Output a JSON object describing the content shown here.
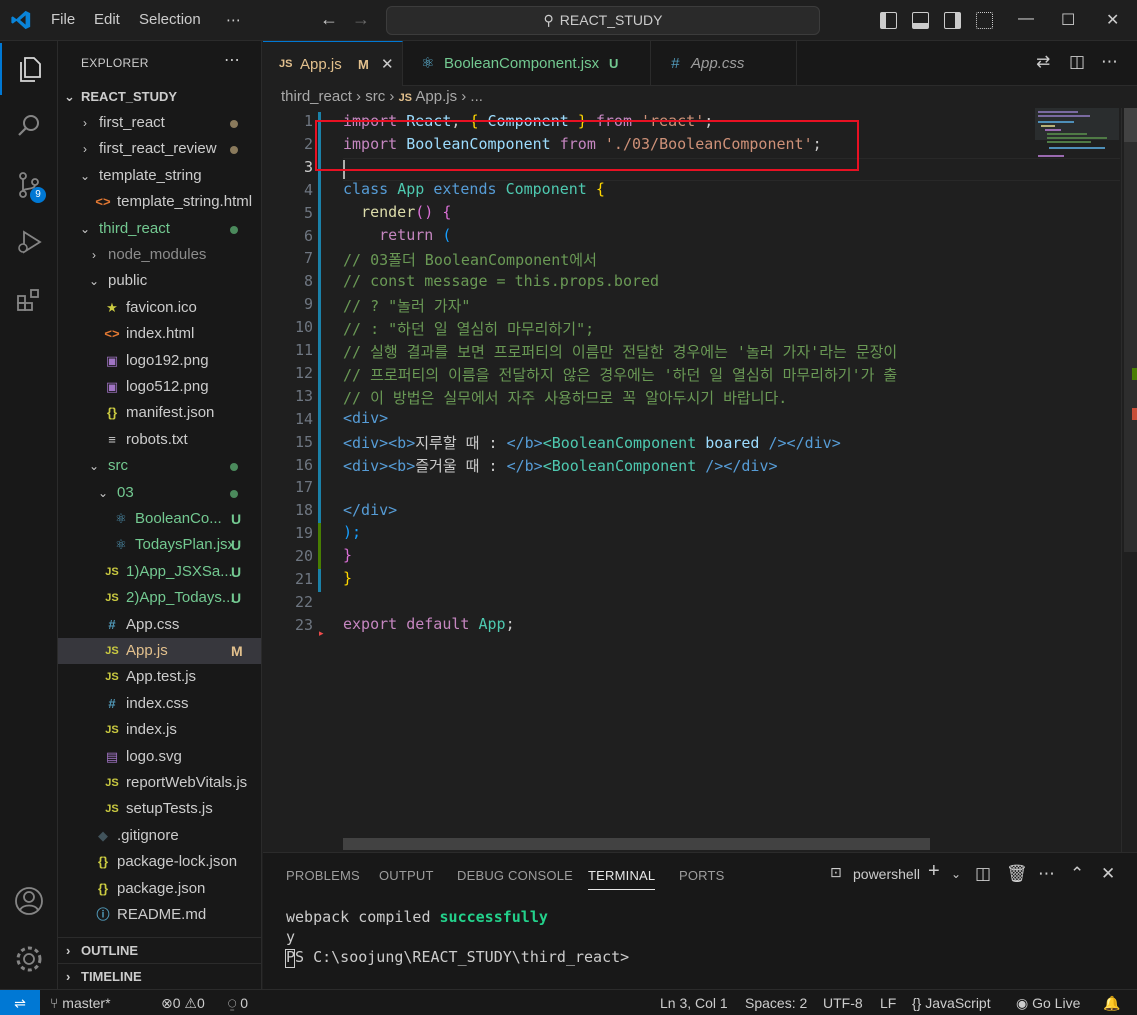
{
  "titlebar": {
    "menu": [
      "File",
      "Edit",
      "Selection",
      "⋯"
    ],
    "search_text": "REACT_STUDY"
  },
  "activity": {
    "scm_badge": "9"
  },
  "sidebar": {
    "title": "EXPLORER",
    "root": "REACT_STUDY",
    "items": [
      {
        "label": "first_react",
        "type": "folder-closed",
        "status": "dot"
      },
      {
        "label": "first_react_review",
        "type": "folder-closed",
        "status": "dot"
      },
      {
        "label": "template_string",
        "type": "folder-open",
        "status": ""
      },
      {
        "label": "template_string.html",
        "type": "html",
        "status": ""
      },
      {
        "label": "third_react",
        "type": "folder-open",
        "status": "dot-green"
      },
      {
        "label": "node_modules",
        "type": "folder-closed",
        "status": ""
      },
      {
        "label": "public",
        "type": "folder-open",
        "status": ""
      },
      {
        "label": "favicon.ico",
        "type": "star",
        "status": ""
      },
      {
        "label": "index.html",
        "type": "html",
        "status": ""
      },
      {
        "label": "logo192.png",
        "type": "image",
        "status": ""
      },
      {
        "label": "logo512.png",
        "type": "image",
        "status": ""
      },
      {
        "label": "manifest.json",
        "type": "json",
        "status": ""
      },
      {
        "label": "robots.txt",
        "type": "text",
        "status": ""
      },
      {
        "label": "src",
        "type": "folder-open",
        "status": "dot-green"
      },
      {
        "label": "03",
        "type": "folder-open",
        "status": "dot-green"
      },
      {
        "label": "BooleanCo...",
        "type": "react",
        "status": "U"
      },
      {
        "label": "TodaysPlan.jsx",
        "type": "react",
        "status": "U"
      },
      {
        "label": "1)App_JSXSa...",
        "type": "js",
        "status": "U"
      },
      {
        "label": "2)App_Todays...",
        "type": "js",
        "status": "U"
      },
      {
        "label": "App.css",
        "type": "css",
        "status": ""
      },
      {
        "label": "App.js",
        "type": "js",
        "status": "M"
      },
      {
        "label": "App.test.js",
        "type": "js",
        "status": ""
      },
      {
        "label": "index.css",
        "type": "css",
        "status": ""
      },
      {
        "label": "index.js",
        "type": "js",
        "status": ""
      },
      {
        "label": "logo.svg",
        "type": "svg",
        "status": ""
      },
      {
        "label": "reportWebVitals.js",
        "type": "js",
        "status": ""
      },
      {
        "label": "setupTests.js",
        "type": "js",
        "status": ""
      },
      {
        "label": ".gitignore",
        "type": "git",
        "status": ""
      },
      {
        "label": "package-lock.json",
        "type": "json",
        "status": ""
      },
      {
        "label": "package.json",
        "type": "json",
        "status": ""
      },
      {
        "label": "README.md",
        "type": "info",
        "status": ""
      }
    ],
    "outline": "OUTLINE",
    "timeline": "TIMELINE"
  },
  "tabs": [
    {
      "label": "App.js",
      "icon": "JS",
      "status": "M"
    },
    {
      "label": "BooleanComponent.jsx",
      "icon": "react",
      "status": "U"
    },
    {
      "label": "App.css",
      "icon": "#",
      "status": ""
    }
  ],
  "breadcrumb": {
    "parts": [
      "third_react",
      "src",
      "App.js",
      "..."
    ]
  },
  "code": {
    "line_numbers": [
      "1",
      "2",
      "3",
      "4",
      "5",
      "6",
      "7",
      "8",
      "9",
      "10",
      "11",
      "12",
      "13",
      "14",
      "15",
      "16",
      "17",
      "18",
      "19",
      "20",
      "21",
      "22",
      "23"
    ],
    "l1": {
      "a": "import",
      "b": "React",
      "c": "{",
      "d": "Component",
      "e": "}",
      "f": "from",
      "g": "'react'"
    },
    "l2": {
      "a": "import",
      "b": "BooleanComponent",
      "c": "from",
      "d": "'./03/BooleanComponent'"
    },
    "l4": {
      "a": "class",
      "b": "App",
      "c": "extends",
      "d": "Component",
      "e": "{"
    },
    "l5": {
      "a": "render",
      "b": "()",
      "c": "{"
    },
    "l6": {
      "a": "return",
      "b": "("
    },
    "l7": "// 03폴더 BooleanComponent에서",
    "l8": "// const message = this.props.bored",
    "l9": "// ? \"놀러 가자\"",
    "l10": "// : \"하던 일 열심히 마무리하기\";",
    "l11": "// 실행 결과를 보면 프로퍼티의 이름만 전달한 경우에는 '놀러 가자'라는 문장이",
    "l12": "// 프로퍼티의 이름을 전달하지 않은 경우에는 '하던 일 열심히 마무리하기'가 출",
    "l13": "// 이 방법은 실무에서 자주 사용하므로 꼭 알아두시기 바랍니다.",
    "l14": "<div>",
    "l15": {
      "open": "<div><b>",
      "text": "지루할 때 : ",
      "close_b": "</b>",
      "comp": "<BooleanComponent",
      "attr": " boared",
      "end": " /></div>"
    },
    "l16": {
      "open": "<div><b>",
      "text": "즐거울 때 : ",
      "close_b": "</b>",
      "comp": "<BooleanComponent",
      "end": " /></div>"
    },
    "l18": "</div>",
    "l19": ");",
    "l20": "}",
    "l21": "}",
    "l23": {
      "a": "export",
      "b": "default",
      "c": "App"
    }
  },
  "panel": {
    "tabs": [
      "PROBLEMS",
      "OUTPUT",
      "DEBUG CONSOLE",
      "TERMINAL",
      "PORTS"
    ],
    "active_tab": "TERMINAL",
    "shell": "powershell",
    "terminal_line1_a": "webpack compiled ",
    "terminal_line1_b": "successfully",
    "terminal_line2": "y",
    "terminal_line3": "PS C:\\soojung\\REACT_STUDY\\third_react>"
  },
  "statusbar": {
    "branch": "master*",
    "errors": "0",
    "warnings": "0",
    "ports": "0",
    "position": "Ln 3, Col 1",
    "spaces": "Spaces: 2",
    "encoding": "UTF-8",
    "eol": "LF",
    "language": "JavaScript",
    "golive": "Go Live"
  },
  "colors": {
    "accent": "#0078d4",
    "highlight_box": "#e81123",
    "modified": "#e2c08d",
    "untracked": "#73c991"
  }
}
